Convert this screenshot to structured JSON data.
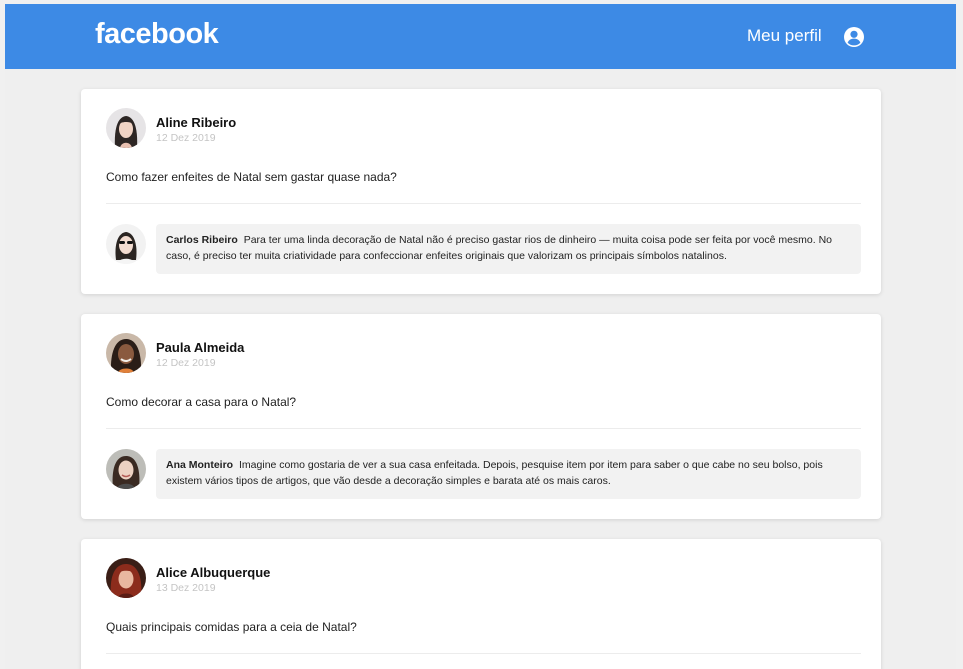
{
  "header": {
    "logo": "facebook",
    "profile_label": "Meu perfil",
    "profile_icon": "user-circle-icon",
    "bg_color": "#3d8ae5"
  },
  "posts": [
    {
      "author": "Aline Ribeiro",
      "date": "12 Dez 2019",
      "text": "Como fazer enfeites de Natal sem gastar quase nada?",
      "comment": {
        "author": "Carlos Ribeiro",
        "text": "Para ter uma linda decoração de Natal não é preciso gastar rios de dinheiro — muita coisa pode ser feita por você mesmo. No caso, é preciso ter muita criatividade para confeccionar enfeites originais que valorizam os principais símbolos natalinos."
      }
    },
    {
      "author": "Paula Almeida",
      "date": "12 Dez 2019",
      "text": "Como decorar a casa para o Natal?",
      "comment": {
        "author": "Ana Monteiro",
        "text": "Imagine como gostaria de ver a sua casa enfeitada. Depois, pesquise item por item para saber o que cabe no seu bolso, pois existem vários tipos de artigos, que vão desde a decoração simples e barata até os mais caros."
      }
    },
    {
      "author": "Alice Albuquerque",
      "date": "13 Dez 2019",
      "text": "Quais principais comidas para a ceia de Natal?"
    }
  ]
}
